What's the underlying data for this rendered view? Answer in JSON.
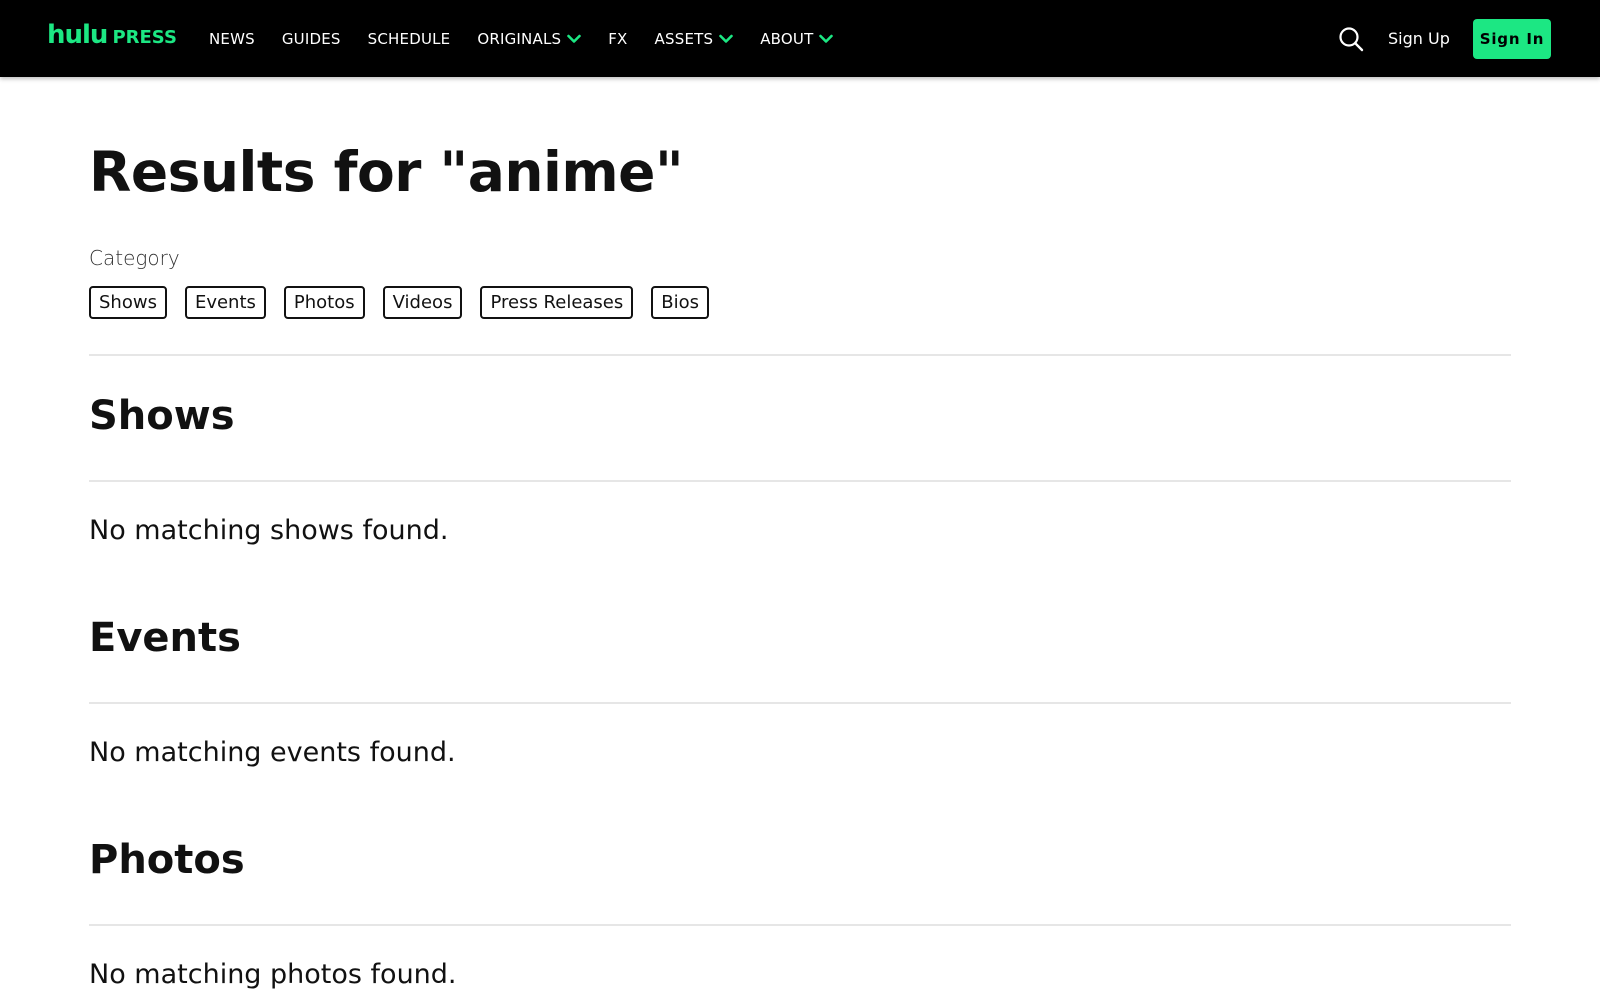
{
  "header": {
    "logo_main": "hulu",
    "logo_sub": "PRESS",
    "nav": [
      {
        "label": "NEWS",
        "dropdown": false
      },
      {
        "label": "GUIDES",
        "dropdown": false
      },
      {
        "label": "SCHEDULE",
        "dropdown": false
      },
      {
        "label": "ORIGINALS",
        "dropdown": true
      },
      {
        "label": "FX",
        "dropdown": false
      },
      {
        "label": "ASSETS",
        "dropdown": true
      },
      {
        "label": "ABOUT",
        "dropdown": true
      }
    ],
    "signup_label": "Sign Up",
    "signin_label": "Sign In"
  },
  "search": {
    "title": "Results for \"anime\"",
    "category_label": "Category",
    "categories": [
      "Shows",
      "Events",
      "Photos",
      "Videos",
      "Press Releases",
      "Bios"
    ]
  },
  "sections": [
    {
      "title": "Shows",
      "message": "No matching shows found."
    },
    {
      "title": "Events",
      "message": "No matching events found."
    },
    {
      "title": "Photos",
      "message": "No matching photos found."
    }
  ],
  "colors": {
    "brand": "#1ce783",
    "nav_bg": "#000000",
    "text": "#111111",
    "divider": "#e6e6e6"
  },
  "icons": {
    "search": "search-icon",
    "dropdown": "chevron-down-icon"
  }
}
